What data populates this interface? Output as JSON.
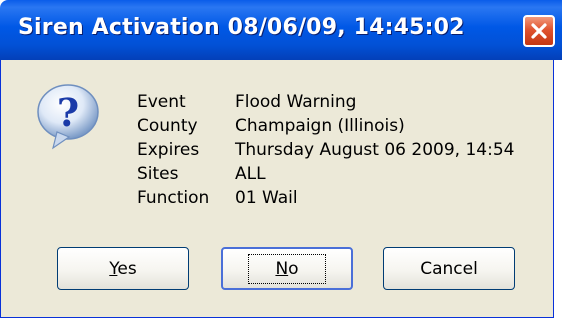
{
  "window": {
    "title": "Siren Activation 08/06/09, 14:45:02",
    "close_icon": "close-icon"
  },
  "dialog": {
    "icon": "question-icon",
    "fields": [
      {
        "label": "Event",
        "value": "Flood Warning"
      },
      {
        "label": "County",
        "value": "Champaign (Illinois)"
      },
      {
        "label": "Expires",
        "value": "Thursday August 06 2009, 14:54"
      },
      {
        "label": "Sites",
        "value": "ALL"
      },
      {
        "label": "Function",
        "value": "01 Wail"
      }
    ]
  },
  "buttons": {
    "yes": {
      "mnemonic": "Y",
      "rest": "es"
    },
    "no": {
      "mnemonic": "N",
      "rest": "o"
    },
    "cancel": "Cancel"
  },
  "colors": {
    "titlebar": "#0058e6",
    "close_button": "#e0532f",
    "dialog_face": "#ece9d8"
  }
}
